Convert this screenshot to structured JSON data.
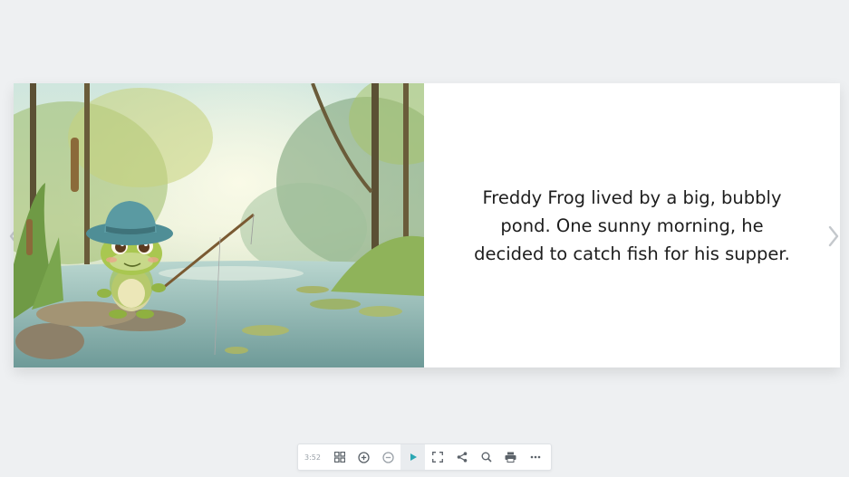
{
  "book": {
    "left_page": {
      "illustration": "freddy-frog-fishing-by-pond"
    },
    "right_page": {
      "text": "Freddy Frog lived by a big, bubbly pond. One sunny morning, he decided to catch fish for his supper."
    }
  },
  "navigation": {
    "prev_icon": "chevron-left-icon",
    "next_icon": "chevron-right-icon"
  },
  "toolbar": {
    "page_indicator": "3:52",
    "buttons": [
      {
        "name": "thumbnails",
        "icon": "grid-icon"
      },
      {
        "name": "zoom-in",
        "icon": "zoom-in-icon"
      },
      {
        "name": "zoom-out",
        "icon": "zoom-out-icon"
      },
      {
        "name": "autoplay",
        "icon": "play-icon"
      },
      {
        "name": "fullscreen",
        "icon": "fullscreen-icon"
      },
      {
        "name": "share",
        "icon": "share-icon"
      },
      {
        "name": "search",
        "icon": "search-icon"
      },
      {
        "name": "print",
        "icon": "print-icon"
      },
      {
        "name": "more",
        "icon": "more-icon"
      }
    ],
    "accent_color": "#2aa7b3"
  }
}
